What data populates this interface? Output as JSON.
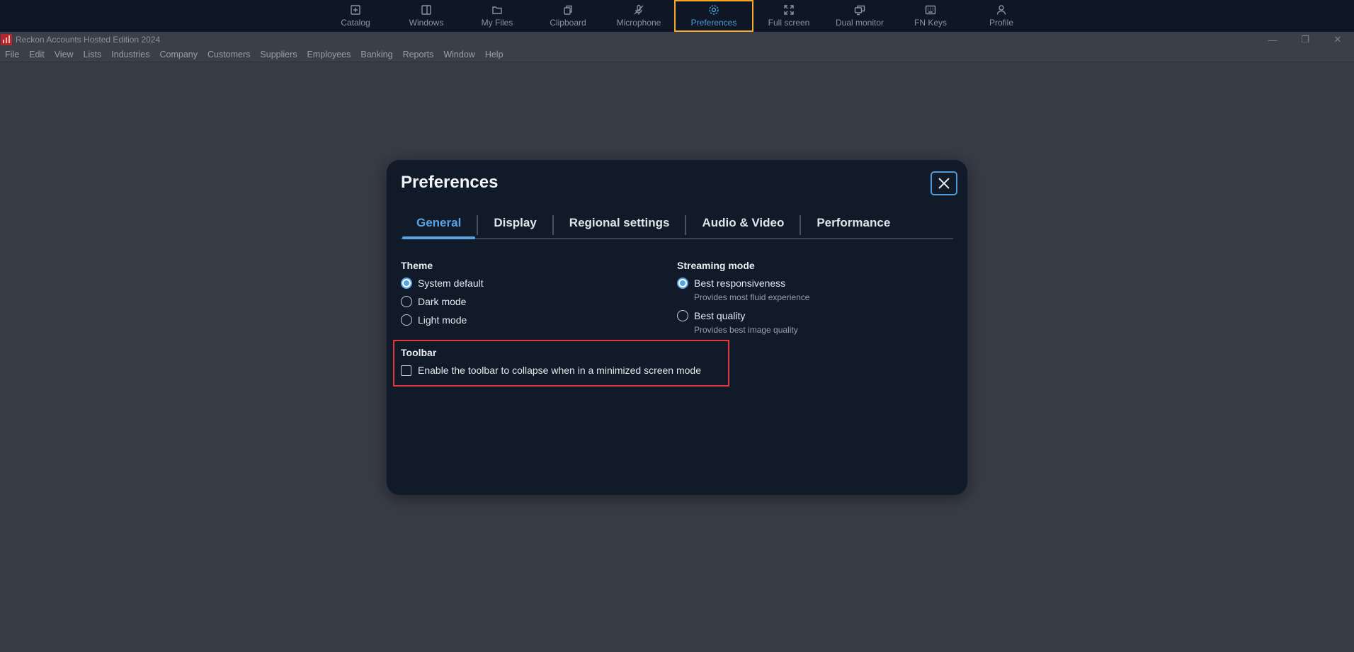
{
  "toolbar": {
    "items": [
      {
        "label": "Catalog",
        "icon": "catalog-icon"
      },
      {
        "label": "Windows",
        "icon": "windows-icon"
      },
      {
        "label": "My Files",
        "icon": "folder-icon"
      },
      {
        "label": "Clipboard",
        "icon": "clipboard-icon"
      },
      {
        "label": "Microphone",
        "icon": "microphone-off-icon"
      },
      {
        "label": "Preferences",
        "icon": "gear-icon",
        "active": true
      },
      {
        "label": "Full screen",
        "icon": "fullscreen-icon"
      },
      {
        "label": "Dual monitor",
        "icon": "dual-monitor-icon"
      },
      {
        "label": "FN Keys",
        "icon": "keyboard-icon"
      },
      {
        "label": "Profile",
        "icon": "user-icon"
      }
    ],
    "active_color": "#4f9bd9",
    "highlight_color": "#f5a623"
  },
  "app": {
    "title": "Reckon Accounts Hosted Edition 2024",
    "window_controls": {
      "minimize": "—",
      "restore": "❐",
      "close": "✕"
    }
  },
  "menu": {
    "items": [
      "File",
      "Edit",
      "View",
      "Lists",
      "Industries",
      "Company",
      "Customers",
      "Suppliers",
      "Employees",
      "Banking",
      "Reports",
      "Window",
      "Help"
    ]
  },
  "dialog": {
    "title": "Preferences",
    "tabs": [
      {
        "label": "General",
        "active": true
      },
      {
        "label": "Display"
      },
      {
        "label": "Regional settings"
      },
      {
        "label": "Audio & Video"
      },
      {
        "label": "Performance"
      }
    ],
    "theme": {
      "label": "Theme",
      "options": [
        {
          "label": "System default",
          "checked": true
        },
        {
          "label": "Dark mode",
          "checked": false
        },
        {
          "label": "Light mode",
          "checked": false
        }
      ]
    },
    "streaming": {
      "label": "Streaming mode",
      "options": [
        {
          "label": "Best responsiveness",
          "hint": "Provides most fluid experience",
          "checked": true
        },
        {
          "label": "Best quality",
          "hint": "Provides best image quality",
          "checked": false
        }
      ]
    },
    "toolbar_section": {
      "label": "Toolbar",
      "checkbox_label": "Enable the toolbar to collapse when in a minimized screen mode",
      "checked": false
    },
    "accent_color": "#5aa3e3",
    "annotation_color": "#e2383b"
  }
}
